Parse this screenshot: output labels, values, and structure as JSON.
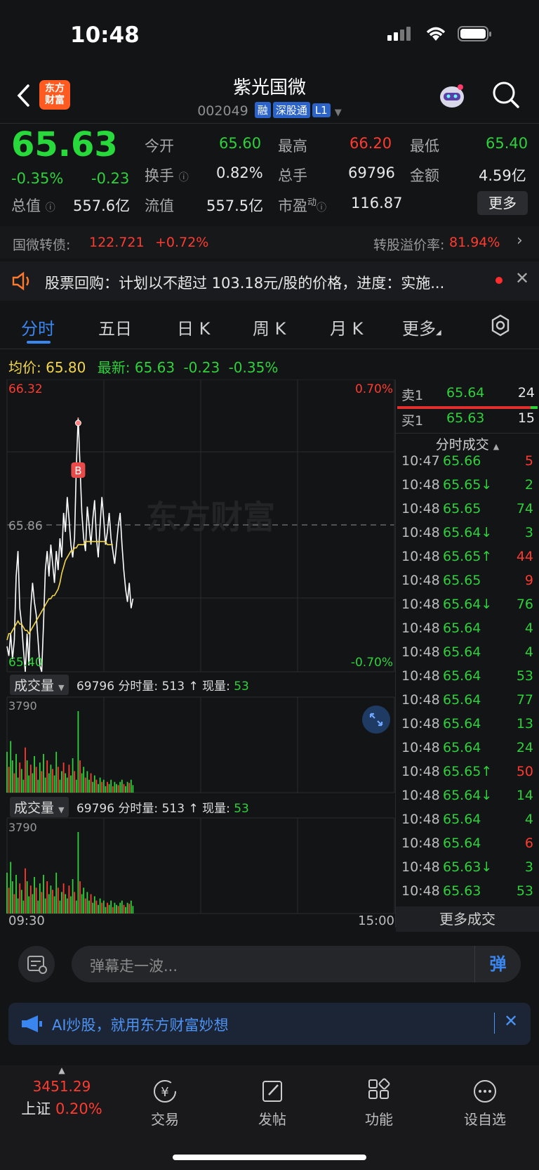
{
  "status": {
    "time": "10:48"
  },
  "header": {
    "logo_line1": "东方",
    "logo_line2": "财富",
    "title": "紫光国微",
    "code": "002049",
    "tags": [
      "融",
      "深股通",
      "L1"
    ]
  },
  "quote": {
    "price": "65.63",
    "change_pct": "-0.35%",
    "change": "-0.23",
    "open_label": "今开",
    "open": "65.60",
    "high_label": "最高",
    "high": "66.20",
    "low_label": "最低",
    "low": "65.40",
    "turnover_label": "换手",
    "turnover": "0.82%",
    "volume_label": "总手",
    "volume": "69796",
    "amount_label": "金额",
    "amount": "4.59亿",
    "mktcap_label": "总值",
    "mktcap": "557.6亿",
    "float_label": "流值",
    "float": "557.5亿",
    "pe_label": "市盈",
    "pe_sup": "动",
    "pe": "116.87",
    "more_label": "更多"
  },
  "bond": {
    "label": "国微转债:",
    "price": "122.721",
    "change": "+0.72%",
    "premium_label": "转股溢价率:",
    "premium": "81.94%"
  },
  "notice": {
    "text": "股票回购：计划以不超过 103.18元/股的价格，进度：实施..."
  },
  "tabs": [
    "分时",
    "五日",
    "日 K",
    "周 K",
    "月 K",
    "更多"
  ],
  "avg_row": {
    "avg_label": "均价:",
    "avg": "65.80",
    "latest_label": "最新:",
    "latest": "65.63",
    "chg": "-0.23",
    "chg_pct": "-0.35%"
  },
  "chart_data": {
    "type": "line",
    "title": "",
    "price_axis": {
      "max": "66.32",
      "mid": "65.86",
      "min": "65.40",
      "max_pct": "0.70%",
      "min_pct": "-0.70%"
    },
    "time_axis": {
      "start": "09:30",
      "end": "15:00"
    },
    "marker": "B",
    "watermark": "东方财富",
    "series": [
      {
        "name": "",
        "color": "#ffffff",
        "values": [
          65.48,
          65.45,
          65.52,
          65.44,
          65.5,
          65.7,
          65.78,
          65.6,
          65.55,
          65.47,
          65.4,
          65.52,
          65.42,
          65.6,
          65.68,
          65.62,
          65.58,
          65.5,
          65.42,
          65.4,
          65.55,
          65.72,
          65.78,
          65.7,
          65.8,
          65.74,
          65.68,
          65.78,
          65.72,
          65.82,
          65.76,
          65.9,
          65.84,
          65.95,
          65.88,
          65.8,
          65.76,
          65.82,
          66.05,
          66.2,
          66.05,
          65.9,
          65.82,
          65.78,
          65.92,
          65.86,
          65.8,
          65.88,
          65.94,
          65.82,
          65.76,
          65.86,
          65.95,
          65.88,
          65.8,
          65.84,
          65.9,
          65.82,
          65.78,
          65.74,
          65.8,
          65.86,
          65.9,
          65.8,
          65.72,
          65.66,
          65.62,
          65.68,
          65.6,
          65.63
        ]
      },
      {
        "name": "",
        "color": "#f2d64b",
        "values": [
          65.5,
          65.52,
          65.52,
          65.53,
          65.54,
          65.55,
          65.56,
          65.55,
          65.55,
          65.54,
          65.53,
          65.53,
          65.52,
          65.53,
          65.54,
          65.55,
          65.56,
          65.57,
          65.58,
          65.59,
          65.6,
          65.61,
          65.62,
          65.63,
          65.63,
          65.64,
          65.64,
          65.65,
          65.66,
          65.68,
          65.71,
          65.73,
          65.75,
          65.76,
          65.77,
          65.78,
          65.78,
          65.79,
          65.79,
          65.8,
          65.8,
          65.8,
          65.8,
          65.81,
          65.81,
          65.81,
          65.81,
          65.81,
          65.81,
          65.81,
          65.81,
          65.81,
          65.81,
          65.81,
          65.81,
          65.8,
          65.8,
          65.8,
          65.8
        ]
      }
    ],
    "volume": {
      "label": "成交量",
      "total": "69796",
      "minute_label": "分时量:",
      "minute": "513",
      "current_label": "现量:",
      "current": "53",
      "ymax": "3790",
      "values": [
        1900,
        1200,
        2400,
        1500,
        900,
        1800,
        700,
        1400,
        1100,
        600,
        2100,
        1500,
        800,
        1300,
        900,
        1700,
        1200,
        600,
        1400,
        1000,
        1800,
        700,
        1500,
        900,
        1300,
        1100,
        800,
        1900,
        1200,
        600,
        1000,
        1400,
        900,
        700,
        1300,
        800,
        1600,
        1000,
        600,
        3790,
        1500,
        900,
        1200,
        700,
        1000,
        600,
        900,
        500,
        800,
        600,
        400,
        700,
        500,
        600,
        300,
        500,
        400,
        600,
        300,
        500,
        400,
        350,
        500,
        600,
        400,
        300,
        500,
        450,
        600,
        350
      ]
    }
  },
  "orderbook": {
    "sell_label": "卖1",
    "sell_price": "65.64",
    "sell_vol": "24",
    "buy_label": "买1",
    "buy_price": "65.63",
    "buy_vol": "15",
    "trades_title": "分时成交",
    "trades": [
      {
        "t": "10:47",
        "p": "65.66",
        "arrow": "",
        "v": "5",
        "c": "red"
      },
      {
        "t": "10:48",
        "p": "65.65",
        "arrow": "↓",
        "v": "2",
        "c": "green"
      },
      {
        "t": "10:48",
        "p": "65.65",
        "arrow": "",
        "v": "74",
        "c": "green"
      },
      {
        "t": "10:48",
        "p": "65.64",
        "arrow": "↓",
        "v": "3",
        "c": "green"
      },
      {
        "t": "10:48",
        "p": "65.65",
        "arrow": "↑",
        "v": "44",
        "c": "red"
      },
      {
        "t": "10:48",
        "p": "65.65",
        "arrow": "",
        "v": "9",
        "c": "red"
      },
      {
        "t": "10:48",
        "p": "65.64",
        "arrow": "↓",
        "v": "76",
        "c": "green"
      },
      {
        "t": "10:48",
        "p": "65.64",
        "arrow": "",
        "v": "4",
        "c": "green"
      },
      {
        "t": "10:48",
        "p": "65.64",
        "arrow": "",
        "v": "4",
        "c": "green"
      },
      {
        "t": "10:48",
        "p": "65.64",
        "arrow": "",
        "v": "53",
        "c": "green"
      },
      {
        "t": "10:48",
        "p": "65.64",
        "arrow": "",
        "v": "77",
        "c": "green"
      },
      {
        "t": "10:48",
        "p": "65.64",
        "arrow": "",
        "v": "13",
        "c": "green"
      },
      {
        "t": "10:48",
        "p": "65.64",
        "arrow": "",
        "v": "24",
        "c": "green"
      },
      {
        "t": "10:48",
        "p": "65.65",
        "arrow": "↑",
        "v": "50",
        "c": "red"
      },
      {
        "t": "10:48",
        "p": "65.64",
        "arrow": "↓",
        "v": "14",
        "c": "green"
      },
      {
        "t": "10:48",
        "p": "65.64",
        "arrow": "",
        "v": "4",
        "c": "green"
      },
      {
        "t": "10:48",
        "p": "65.64",
        "arrow": "",
        "v": "6",
        "c": "red"
      },
      {
        "t": "10:48",
        "p": "65.63",
        "arrow": "↓",
        "v": "3",
        "c": "green"
      },
      {
        "t": "10:48",
        "p": "65.63",
        "arrow": "",
        "v": "53",
        "c": "green"
      }
    ],
    "more_trades": "更多成交"
  },
  "comment": {
    "placeholder": "弹幕走一波...",
    "send": "弹"
  },
  "ai_banner": {
    "text": "AI炒股，就用东方财富妙想"
  },
  "tabbar": {
    "index_value": "3451.29",
    "index_name": "上证",
    "index_change": "0.20%",
    "items": [
      "交易",
      "发帖",
      "功能",
      "设自选"
    ]
  }
}
